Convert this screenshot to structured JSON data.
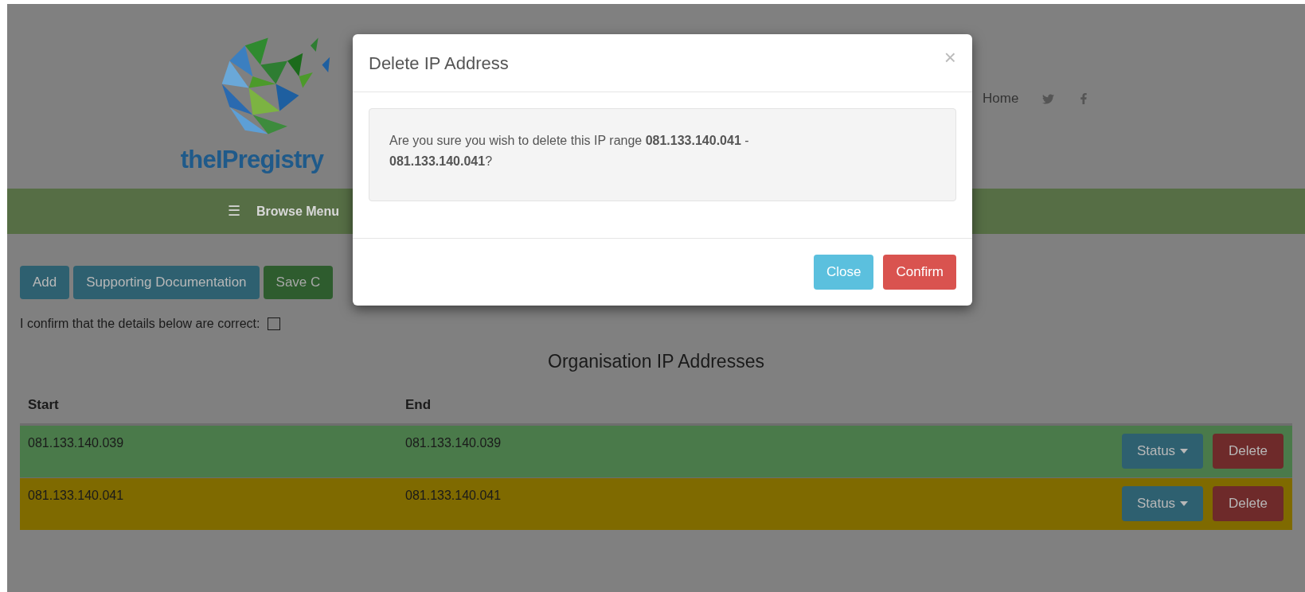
{
  "header": {
    "logo_text": "theIPregistry",
    "nav": [
      {
        "kind": "link",
        "label": "Home"
      },
      {
        "kind": "twitter"
      },
      {
        "kind": "facebook"
      }
    ]
  },
  "menu_bar": {
    "icon": "☰",
    "label": "Browse Menu"
  },
  "actions": [
    {
      "label": "Add",
      "kind": "info"
    },
    {
      "label": "Supporting Documentation",
      "kind": "info"
    },
    {
      "label": "Save C",
      "kind": "success"
    }
  ],
  "confirm": {
    "label": "I confirm that the details below are correct:",
    "checked": false
  },
  "table": {
    "title": "Organisation IP Addresses",
    "columns": [
      "Start",
      "End"
    ],
    "rows": [
      {
        "start": "081.133.140.039",
        "end": "081.133.140.039",
        "color": "#4a7a4a",
        "status": "Status",
        "delete": "Delete"
      },
      {
        "start": "081.133.140.041",
        "end": "081.133.140.041",
        "color": "#7f6a00",
        "status": "Status",
        "delete": "Delete"
      }
    ]
  },
  "modal": {
    "title": "Delete IP Address",
    "close_icon": "×",
    "message": "Are you sure you wish to delete this IP range **081.133.140.041** - **081.133.140.041**?",
    "buttons": [
      {
        "label": "Close",
        "kind": "info"
      },
      {
        "label": "Confirm",
        "kind": "danger"
      }
    ]
  }
}
